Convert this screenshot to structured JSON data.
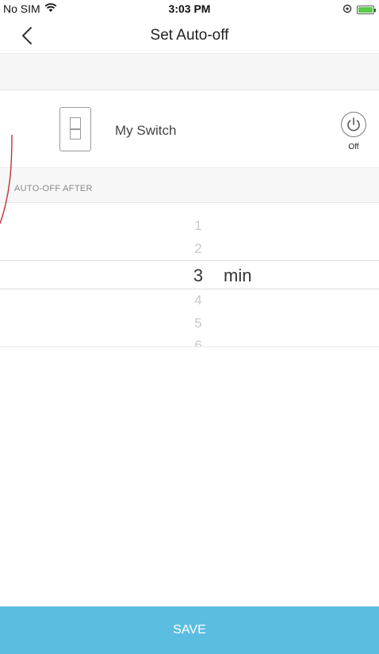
{
  "status_bar": {
    "carrier": "No SIM",
    "time": "3:03 PM"
  },
  "nav": {
    "title": "Set Auto-off"
  },
  "device": {
    "name": "My Switch",
    "power_state": "Off"
  },
  "section": {
    "title": "AUTO-OFF AFTER"
  },
  "picker": {
    "values": [
      "1",
      "2",
      "3",
      "4",
      "5",
      "6"
    ],
    "selected": "3",
    "unit": "min"
  },
  "footer": {
    "save_label": "SAVE"
  },
  "colors": {
    "accent": "#5cbde3",
    "battery": "#5ac84a"
  }
}
